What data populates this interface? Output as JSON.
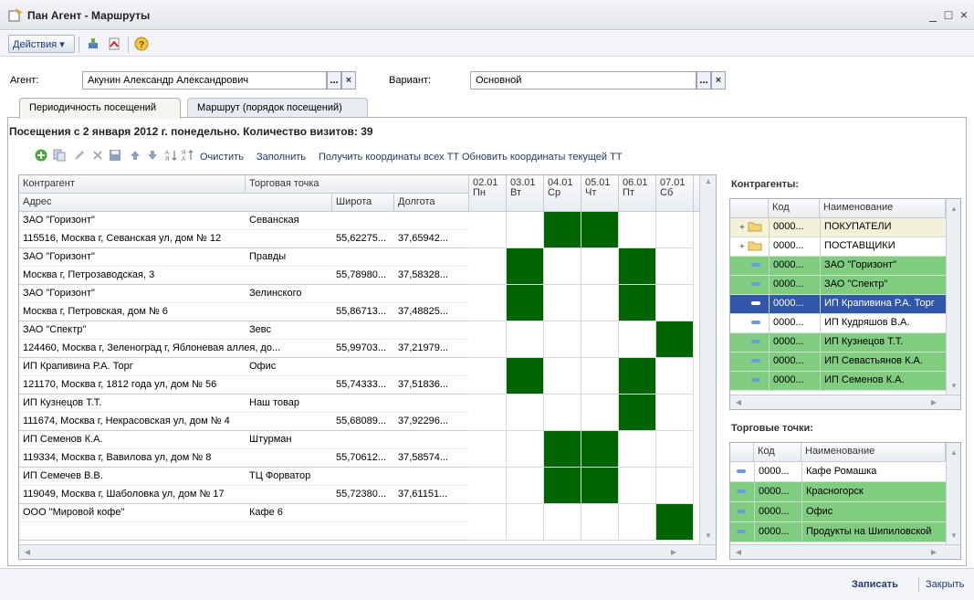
{
  "window": {
    "title": "Пан Агент - Маршруты",
    "controls": [
      "_",
      "□",
      "×"
    ]
  },
  "toolbar": {
    "actions_label": "Действия ▾"
  },
  "agent": {
    "label": "Агент:",
    "value": "Акунин Александр Александрович",
    "btn_more": "...",
    "btn_clear": "×"
  },
  "variant": {
    "label": "Вариант:",
    "value": "Основной",
    "btn_more": "...",
    "btn_clear": "×"
  },
  "tabs": [
    {
      "label": "Периодичность посещений"
    },
    {
      "label": "Маршрут (порядок посещений)"
    }
  ],
  "heading": "Посещения с 2 января 2012 г. понедельно. Количество визитов: 39",
  "table_toolbar": {
    "clear": "Очистить",
    "fill": "Заполнить",
    "get_all": "Получить координаты всех ТТ",
    "update": "Обновить координаты текущей ТТ"
  },
  "grid": {
    "headers": {
      "counterparty": "Контрагент",
      "point": "Торговая точка",
      "address": "Адрес",
      "lat": "Широта",
      "lon": "Долгота"
    },
    "days": [
      {
        "date": "02.01",
        "dow": "Пн"
      },
      {
        "date": "03.01",
        "dow": "Вт"
      },
      {
        "date": "04.01",
        "dow": "Ср"
      },
      {
        "date": "05.01",
        "dow": "Чт"
      },
      {
        "date": "06.01",
        "dow": "Пт"
      },
      {
        "date": "07.01",
        "dow": "Сб"
      }
    ],
    "rows": [
      {
        "counterparty": "ЗАО \"Горизонт\"",
        "point": "Севанская",
        "address": "115516, Москва г, Севанская ул, дом № 12",
        "lat": "55,62275...",
        "lon": "37,65942...",
        "visits": [
          0,
          0,
          1,
          1,
          0,
          0
        ]
      },
      {
        "counterparty": "ЗАО \"Горизонт\"",
        "point": "Правды",
        "address": "Москва г, Петрозаводская, 3",
        "lat": "55,78980...",
        "lon": "37,58328...",
        "visits": [
          0,
          1,
          0,
          0,
          1,
          0
        ]
      },
      {
        "counterparty": "ЗАО \"Горизонт\"",
        "point": "Зелинского",
        "address": "Москва г, Петровская, дом № 6",
        "lat": "55,86713...",
        "lon": "37,48825...",
        "visits": [
          0,
          1,
          0,
          0,
          1,
          0
        ]
      },
      {
        "counterparty": "ЗАО \"Спектр\"",
        "point": "Зевс",
        "address": "124460, Москва г, Зеленоград г, Яблоневая аллея, до...",
        "lat": "55,99703...",
        "lon": "37,21979...",
        "visits": [
          0,
          0,
          0,
          0,
          0,
          1
        ]
      },
      {
        "counterparty": "ИП Крапивина Р.А. Торг",
        "point": "Офис",
        "address": "121170, Москва г, 1812 года ул, дом № 56",
        "lat": "55,74333...",
        "lon": "37,51836...",
        "visits": [
          0,
          1,
          0,
          0,
          1,
          0
        ]
      },
      {
        "counterparty": "ИП Кузнецов Т.Т.",
        "point": "Наш товар",
        "address": "111674, Москва г, Некрасовская ул, дом № 4",
        "lat": "55,68089...",
        "lon": "37,92296...",
        "visits": [
          0,
          0,
          0,
          0,
          1,
          0
        ]
      },
      {
        "counterparty": "ИП Семенов К.А.",
        "point": "Штурман",
        "address": "119334, Москва г, Вавилова ул, дом № 8",
        "lat": "55,70612...",
        "lon": "37,58574...",
        "visits": [
          0,
          0,
          1,
          1,
          0,
          0
        ]
      },
      {
        "counterparty": "ИП Семечев В.В.",
        "point": "ТЦ Форватор",
        "address": "119049, Москва г, Шаболовка ул, дом № 17",
        "lat": "55,72380...",
        "lon": "37,61151...",
        "visits": [
          0,
          0,
          1,
          1,
          0,
          0
        ]
      },
      {
        "counterparty": "ООО \"Мировой кофе\"",
        "point": "Кафе 6",
        "address": "",
        "lat": "",
        "lon": "",
        "visits": [
          0,
          0,
          0,
          0,
          0,
          1
        ]
      }
    ]
  },
  "contractors": {
    "title": "Контрагенты:",
    "headers": {
      "code": "Код",
      "name": "Наименование"
    },
    "rows": [
      {
        "code": "0000...",
        "name": "ПОКУПАТЕЛИ",
        "kind": "folder-open",
        "style": "y"
      },
      {
        "code": "0000...",
        "name": "ПОСТАВЩИКИ",
        "kind": "folder",
        "style": "w"
      },
      {
        "code": "0000...",
        "name": "ЗАО \"Горизонт\"",
        "kind": "item",
        "style": "g"
      },
      {
        "code": "0000...",
        "name": "ЗАО \"Спектр\"",
        "kind": "item",
        "style": "g"
      },
      {
        "code": "0000...",
        "name": "ИП Крапивина Р.А. Торг",
        "kind": "item",
        "style": "sel"
      },
      {
        "code": "0000...",
        "name": "ИП Кудряшов В.А.",
        "kind": "item",
        "style": "w"
      },
      {
        "code": "0000...",
        "name": "ИП Кузнецов Т.Т.",
        "kind": "item",
        "style": "g"
      },
      {
        "code": "0000...",
        "name": "ИП Севастьянов К.А.",
        "kind": "item",
        "style": "g"
      },
      {
        "code": "0000...",
        "name": "ИП Семенов К.А.",
        "kind": "item",
        "style": "g"
      }
    ]
  },
  "points": {
    "title": "Торговые точки:",
    "headers": {
      "code": "Код",
      "name": "Наименование"
    },
    "rows": [
      {
        "code": "0000...",
        "name": "Кафе Ромашка",
        "style": "w"
      },
      {
        "code": "0000...",
        "name": "Красногорск",
        "style": "g"
      },
      {
        "code": "0000...",
        "name": "Офис",
        "style": "g"
      },
      {
        "code": "0000...",
        "name": "Продукты на Шипиловской",
        "style": "g"
      }
    ]
  },
  "footer": {
    "save": "Записать",
    "close": "Закрыть"
  },
  "colors": {
    "visit": "#006400",
    "row_highlight": "#80cc80",
    "selection": "#3357a8"
  }
}
